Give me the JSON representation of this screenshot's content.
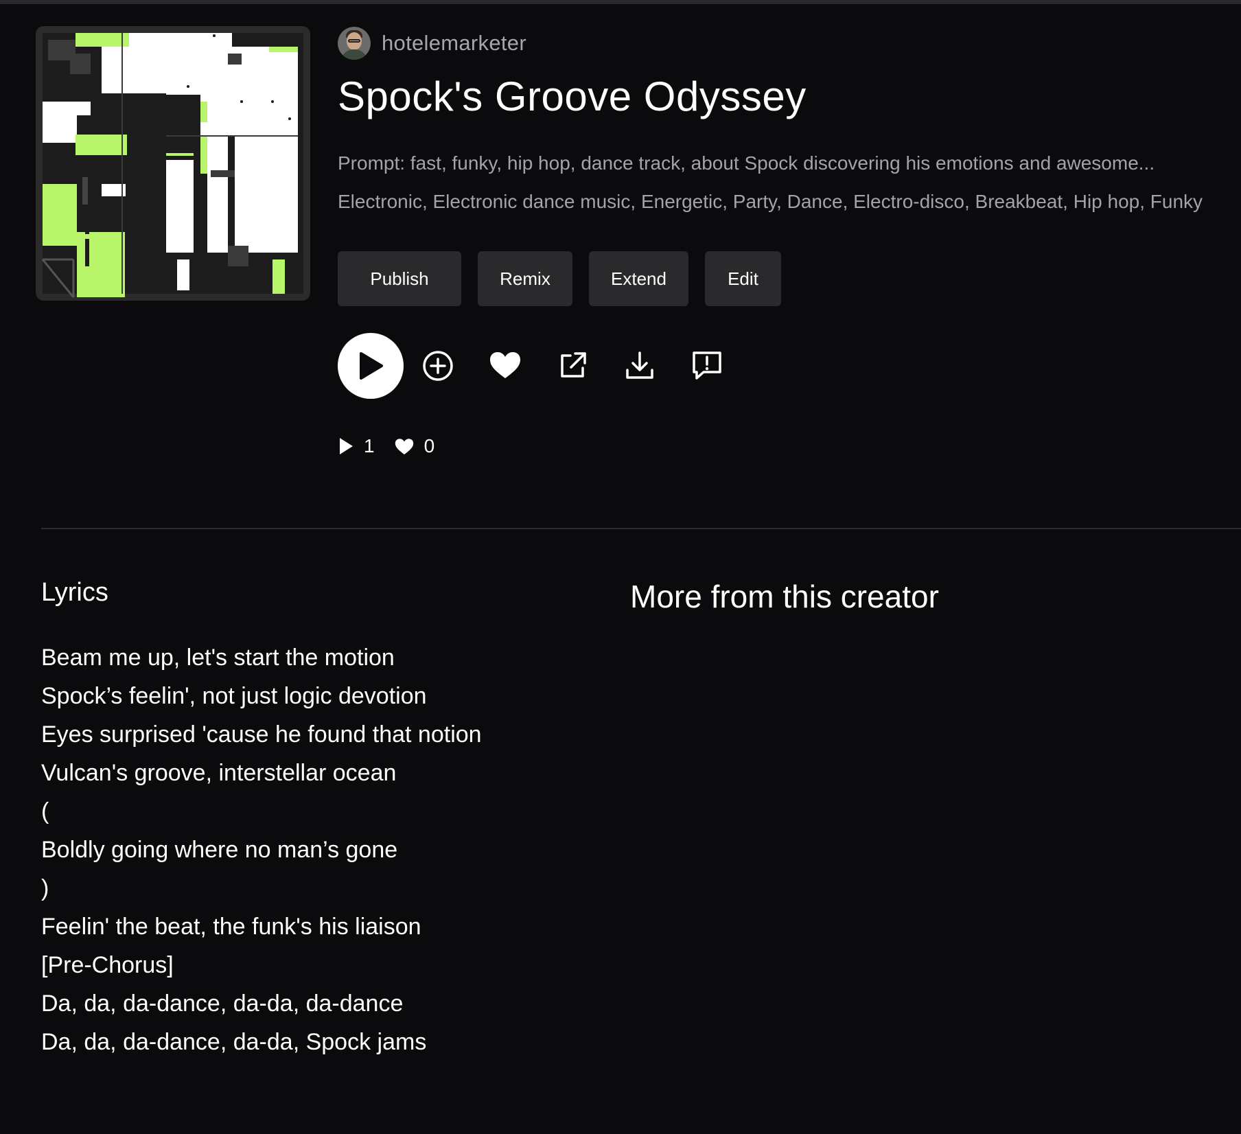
{
  "creator": {
    "username": "hotelemarketer"
  },
  "song": {
    "title": "Spock's Groove Odyssey",
    "prompt": "Prompt: fast, funky, hip hop, dance track, about Spock discovering his emotions and awesome...",
    "tags": "Electronic, Electronic dance music, Energetic, Party, Dance, Electro-disco, Breakbeat, Hip hop, Funky"
  },
  "actions": {
    "publish": "Publish",
    "remix": "Remix",
    "extend": "Extend",
    "edit": "Edit"
  },
  "icons": {
    "play": "play-icon",
    "add": "add-circle-icon",
    "like": "heart-icon",
    "share": "external-link-icon",
    "download": "download-icon",
    "report": "report-icon"
  },
  "stats": {
    "plays": "1",
    "likes": "0"
  },
  "lyrics": {
    "heading": "Lyrics",
    "lines": [
      "Beam me up, let's start the motion",
      "Spock’s feelin', not just logic devotion",
      "Eyes surprised 'cause he found that notion",
      "Vulcan's groove, interstellar ocean",
      "(",
      "Boldly going where no man’s gone",
      ")",
      "Feelin' the beat, the funk's his liaison",
      "[Pre-Chorus]",
      "Da, da, da-dance, da-da, da-dance",
      "Da, da, da-dance, da-da, Spock jams"
    ]
  },
  "more": {
    "heading": "More from this creator"
  },
  "colors": {
    "background": "#0b0b0d",
    "button": "#2a2a2d",
    "muted_text": "#a4a4a8",
    "accent_green": "#b8f56a"
  }
}
